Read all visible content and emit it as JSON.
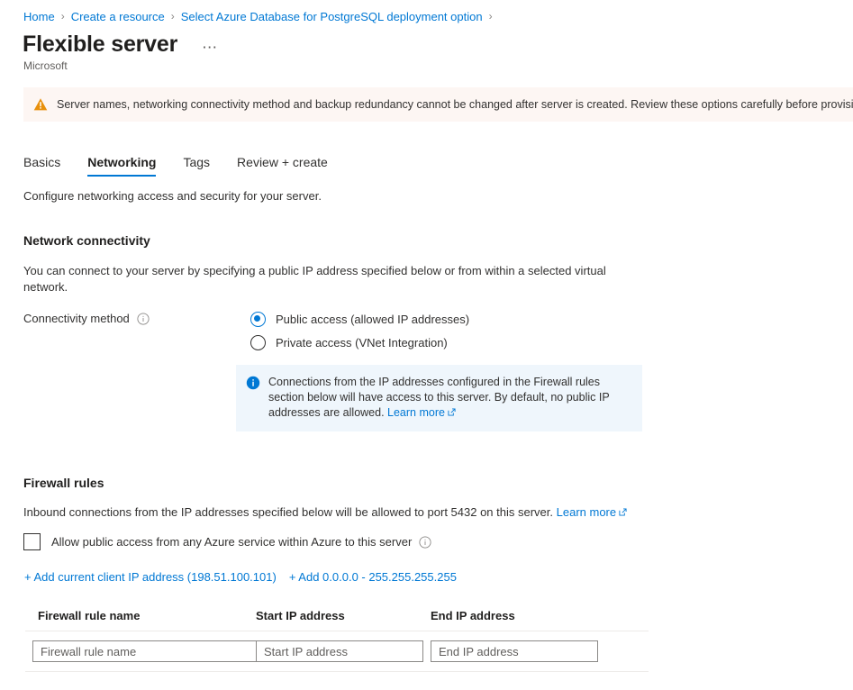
{
  "breadcrumb": {
    "items": [
      {
        "label": "Home"
      },
      {
        "label": "Create a resource"
      },
      {
        "label": "Select Azure Database for PostgreSQL deployment option"
      }
    ],
    "separator": "›"
  },
  "header": {
    "title": "Flexible server",
    "publisher": "Microsoft",
    "more_label": "⋯"
  },
  "warning": {
    "icon": "warning-triangle-icon",
    "text": "Server names, networking connectivity method and backup redundancy cannot be changed after server is created. Review these options carefully before provisioning"
  },
  "tabs": [
    {
      "label": "Basics",
      "active": false
    },
    {
      "label": "Networking",
      "active": true
    },
    {
      "label": "Tags",
      "active": false
    },
    {
      "label": "Review + create",
      "active": false
    }
  ],
  "main": {
    "intro": "Configure networking access and security for your server.",
    "network_connectivity": {
      "heading": "Network connectivity",
      "description": "You can connect to your server by specifying a public IP address specified below or from within a selected virtual network.",
      "field_label": "Connectivity method",
      "options": [
        {
          "label": "Public access (allowed IP addresses)",
          "selected": true
        },
        {
          "label": "Private access (VNet Integration)",
          "selected": false
        }
      ],
      "info_box": {
        "text": "Connections from the IP addresses configured in the Firewall rules section below will have access to this server. By default, no public IP addresses are allowed.",
        "link_label": "Learn more"
      }
    },
    "firewall_rules": {
      "heading": "Firewall rules",
      "description": "Inbound connections from the IP addresses specified below will be allowed to port 5432 on this server.",
      "description_link": "Learn more",
      "allow_azure_checkbox": {
        "label": "Allow public access from any Azure service within Azure to this server",
        "checked": false
      },
      "add_client_ip_link": "+ Add current client IP address (198.51.100.101)",
      "add_all_ip_link": "+ Add 0.0.0.0 - 255.255.255.255",
      "columns": [
        "Firewall rule name",
        "Start IP address",
        "End IP address"
      ],
      "rows": [
        {
          "name_value": "",
          "name_placeholder": "Firewall rule name",
          "start_value": "",
          "start_placeholder": "Start IP address",
          "end_value": "",
          "end_placeholder": "End IP address"
        }
      ]
    }
  },
  "colors": {
    "accent": "#0078d4",
    "warning_bg": "#fdf6f3",
    "warning_icon": "#e8900c",
    "info_bg": "#eff6fc",
    "info_icon": "#0078d4",
    "text": "#323130"
  }
}
